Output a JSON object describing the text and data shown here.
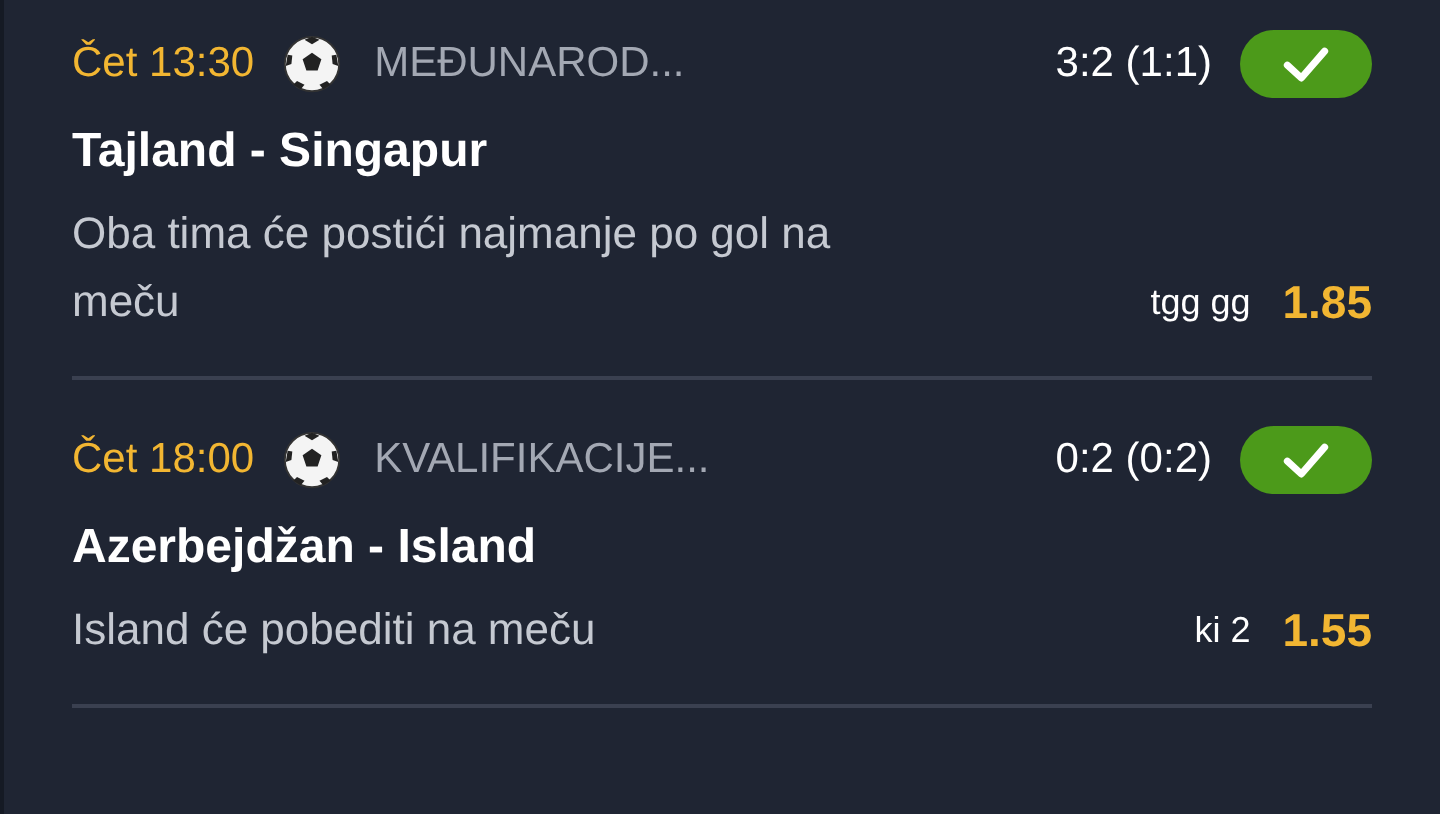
{
  "bets": [
    {
      "time": "Čet 13:30",
      "kind": "football",
      "league": "MEĐUNAROD...",
      "score": "3:2 (1:1)",
      "won": true,
      "match": "Tajland - Singapur",
      "pick": "Oba tima će postići najmanje po gol na meču",
      "market": "tgg gg",
      "odds": "1.85"
    },
    {
      "time": "Čet 18:00",
      "kind": "football",
      "league": "KVALIFIKACIJE...",
      "score": "0:2 (0:2)",
      "won": true,
      "match": "Azerbejdžan - Island",
      "pick": "Island će pobediti na meču",
      "market": "ki 2",
      "odds": "1.55"
    }
  ]
}
